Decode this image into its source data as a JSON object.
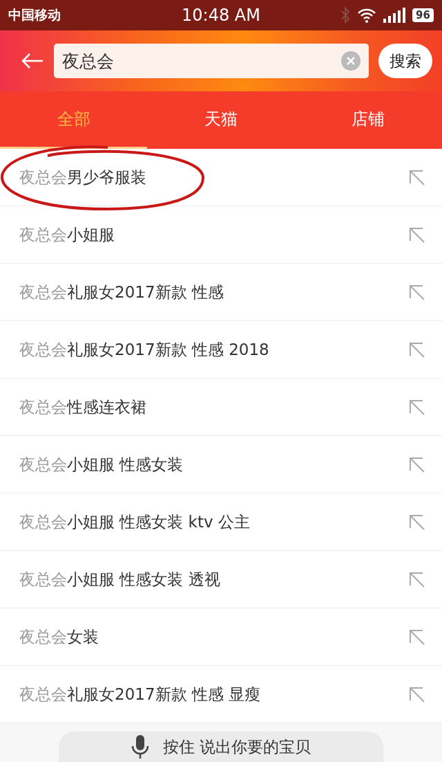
{
  "status_bar": {
    "carrier": "中国移动",
    "time": "10:48 AM",
    "battery": "96"
  },
  "search": {
    "value": "夜总会",
    "button": "搜索"
  },
  "tabs": [
    {
      "label": "全部",
      "selected": true
    },
    {
      "label": "天猫",
      "selected": false
    },
    {
      "label": "店铺",
      "selected": false
    }
  ],
  "suggestions": [
    {
      "match": "夜总会",
      "rest": "男少爷服装",
      "circled": true
    },
    {
      "match": "夜总会",
      "rest": "小姐服",
      "circled": false
    },
    {
      "match": "夜总会",
      "rest": "礼服女2017新款 性感",
      "circled": false
    },
    {
      "match": "夜总会",
      "rest": "礼服女2017新款 性感 2018",
      "circled": false
    },
    {
      "match": "夜总会",
      "rest": "性感连衣裙",
      "circled": false
    },
    {
      "match": "夜总会",
      "rest": "小姐服 性感女装",
      "circled": false
    },
    {
      "match": "夜总会",
      "rest": "小姐服 性感女装 ktv 公主",
      "circled": false
    },
    {
      "match": "夜总会",
      "rest": "小姐服 性感女装 透视",
      "circled": false
    },
    {
      "match": "夜总会",
      "rest": "女装",
      "circled": false
    },
    {
      "match": "夜总会",
      "rest": "礼服女2017新款 性感 显瘦",
      "circled": false
    }
  ],
  "voice_bar": {
    "label": "按住 说出你要的宝贝"
  }
}
